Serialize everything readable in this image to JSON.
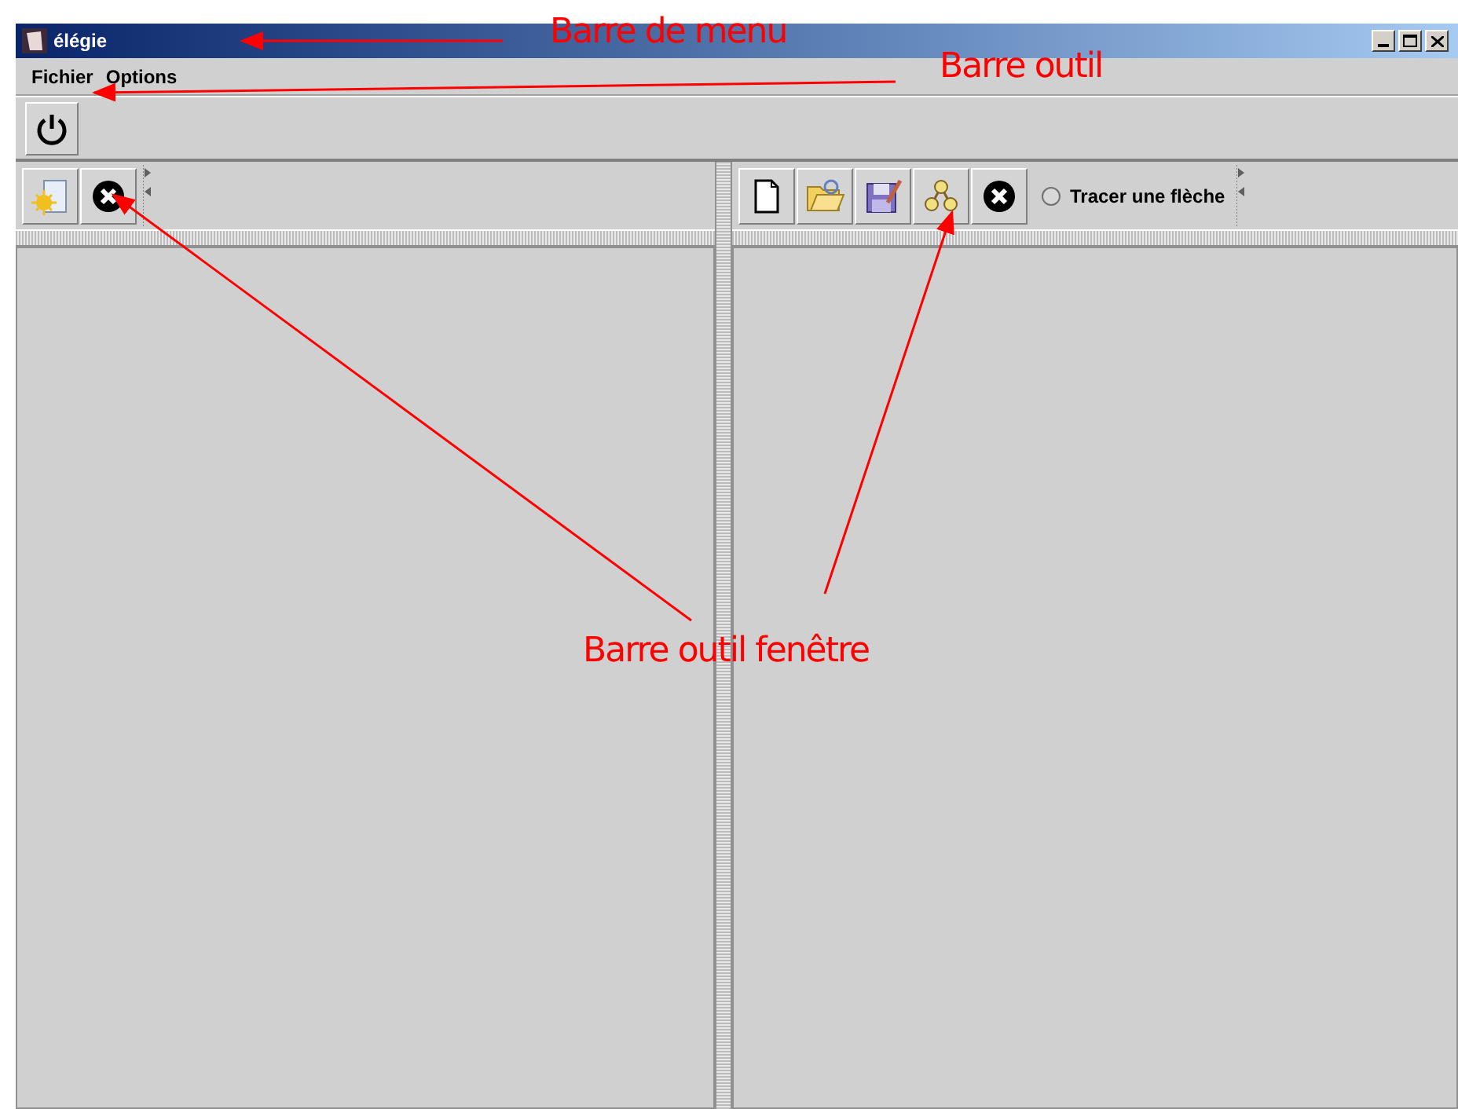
{
  "window": {
    "title": "élégie"
  },
  "menu": [
    {
      "label": "Fichier"
    },
    {
      "label": "Options"
    }
  ],
  "toolbar": [
    {
      "kind": "power"
    }
  ],
  "left_pane": {
    "toolbar": [
      {
        "kind": "new"
      },
      {
        "kind": "close"
      }
    ]
  },
  "right_pane": {
    "toolbar": [
      {
        "kind": "page"
      },
      {
        "kind": "open"
      },
      {
        "kind": "save"
      },
      {
        "kind": "graph"
      },
      {
        "kind": "close"
      }
    ],
    "radio": {
      "label": "Tracer une flèche",
      "checked": false
    }
  },
  "annotations": [
    {
      "text": "Barre de menu"
    },
    {
      "text": "Barre outil"
    },
    {
      "text": "Barre outil fenêtre"
    }
  ]
}
